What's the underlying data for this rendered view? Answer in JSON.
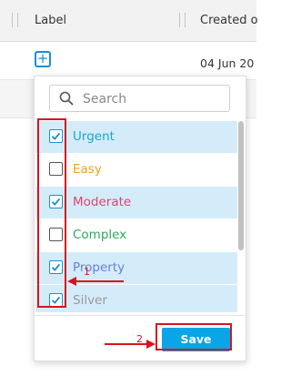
{
  "table": {
    "columns": [
      "Label",
      "Created o"
    ],
    "rows": [
      {
        "date": "04 Jun 20"
      }
    ]
  },
  "filter": {
    "search_placeholder": "Search",
    "options": [
      {
        "label": "Urgent",
        "checked": true,
        "color": "#1fa3cf"
      },
      {
        "label": "Easy",
        "checked": false,
        "color": "#f0a11a"
      },
      {
        "label": "Moderate",
        "checked": true,
        "color": "#e0436b"
      },
      {
        "label": "Complex",
        "checked": false,
        "color": "#2aaa5a"
      },
      {
        "label": "Property",
        "checked": true,
        "color": "#6a7fd8"
      },
      {
        "label": "Silver",
        "checked": true,
        "color": "#999999"
      }
    ],
    "save_label": "Save"
  },
  "annotations": {
    "marker_1": "1",
    "marker_2": "2",
    "color": "#d6141e"
  },
  "colors": {
    "accent": "#0aa5e6",
    "selected_bg": "#d4ecf9"
  }
}
